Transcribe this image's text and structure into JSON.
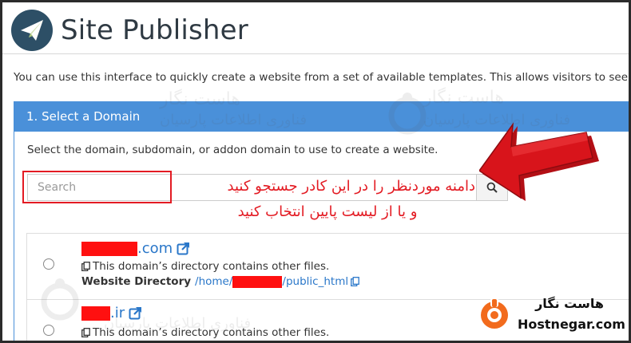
{
  "header": {
    "title": "Site Publisher"
  },
  "intro": "You can use this interface to quickly create a website from a set of available templates. This allows visitors to see some",
  "panel": {
    "heading": "1. Select a Domain",
    "description": "Select the domain, subdomain, or addon domain to use to create a website."
  },
  "search": {
    "placeholder": "Search"
  },
  "annotation": {
    "line1": "دامنه موردنظر را در این کادر جستجو کنید",
    "line2": "و یا از لیست پایین انتخاب کنید"
  },
  "domains": [
    {
      "tld": ".com",
      "note": "This domain’s directory contains other files.",
      "dir_label": "Website Directory",
      "dir_prefix": "/home/",
      "dir_suffix": "/public_html"
    },
    {
      "tld": ".ir",
      "note": "This domain’s directory contains other files."
    }
  ],
  "brand": {
    "name_fa": "هاست نگار",
    "name_en": "Hostnegar.com"
  },
  "watermark": {
    "name_fa": "هاست نگار",
    "subtitle_fa": "فناوری اطلاعات پارسیان"
  },
  "colors": {
    "accent": "#4a90d9",
    "annotation": "#e31b23",
    "link": "#2a77c9",
    "brand_orange": "#f26b1d"
  }
}
